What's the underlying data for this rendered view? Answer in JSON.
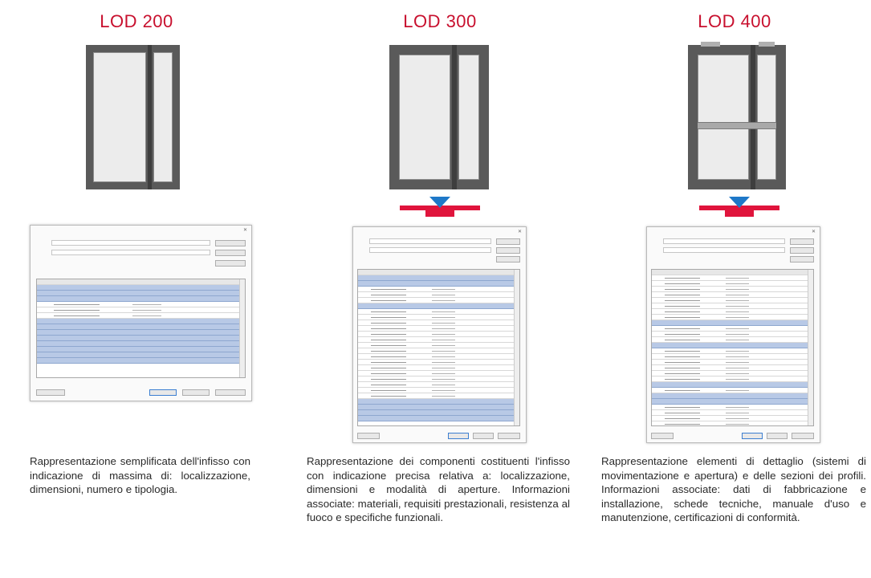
{
  "columns": [
    {
      "title": "LOD 200",
      "description": "Rappresentazione semplificata dell'infisso con indicazione di massima di: localizzazione, dimensioni, numero e tipologia."
    },
    {
      "title": "LOD 300",
      "description": "Rappresentazione dei componenti costituenti l'infisso con indicazione precisa relativa a: localizzazione, dimensioni e modalità di aperture. Informazioni associate: materiali, requisiti prestazionali, resistenza al fuoco e specifiche funzionali."
    },
    {
      "title": "LOD 400",
      "description": "Rappresentazione elementi di dettaglio (sistemi di movimentazione e apertura) e delle sezioni dei profili. Informazioni associate: dati di fabbricazione e installazione, schede tecniche, manuale d'uso e manutenzione, certificazioni di conformità."
    }
  ],
  "colors": {
    "title": "#c8102e",
    "frame": "#5a5a5a",
    "profile": "#e0143c",
    "marker": "#1e78c8",
    "group_row": "#b8c9e6"
  }
}
